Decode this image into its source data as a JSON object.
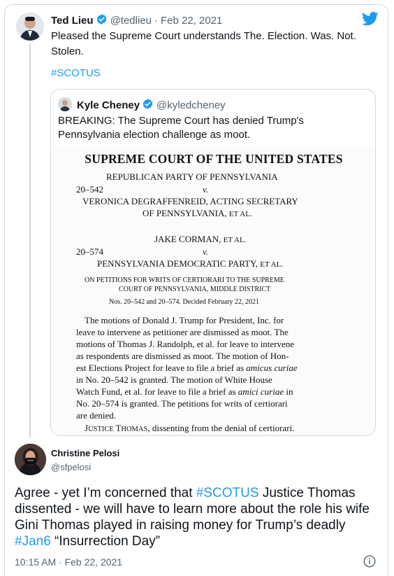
{
  "parent": {
    "name": "Ted Lieu",
    "handle": "@tedlieu",
    "separator": "·",
    "date": "Feb 22, 2021",
    "text": "Pleased the Supreme Court understands The. Election. Was. Not. Stolen.",
    "hashtag": "#SCOTUS"
  },
  "quote": {
    "name": "Kyle Cheney",
    "handle": "@kyledcheney",
    "text": "BREAKING: The Supreme Court has denied Trump's Pennsylvania election challenge as moot.",
    "document": {
      "title": "SUPREME COURT OF THE UNITED STATES",
      "case1_party1": "REPUBLICAN PARTY OF PENNSYLVANIA",
      "case1_number": "20–542",
      "v": "v.",
      "case1_party2_line1": "VERONICA DEGRAFFENREID, ACTING SECRETARY",
      "case1_party2_line2": "OF PENNSYLVANIA,",
      "et_al": "ET AL.",
      "case2_party1": "JAKE CORMAN,",
      "case2_number": "20–574",
      "case2_party2": "PENNSYLVANIA DEMOCRATIC PARTY,",
      "petitions_line1": "ON PETITIONS FOR WRITS OF CERTIORARI TO THE SUPREME",
      "petitions_line2": "COURT OF PENNSYLVANIA, MIDDLE DISTRICT",
      "nos_decided": "Nos. 20–542 and 20–574.   Decided February 22, 2021",
      "body_lines": [
        "The motions of Donald J. Trump for President, Inc. for",
        "leave to intervene as petitioner are dismissed as moot.  The",
        "motions of Thomas J. Randolph, et al. for leave to intervene",
        "as respondents are dismissed as moot.  The motion of Hon-",
        "est Elections Project for leave to file a brief as amicus curiae",
        "in No. 20–542 is granted.  The motion of White House",
        "Watch Fund, et al. for leave to file a brief as amici curiae in",
        "No. 20–574 is granted.  The petitions for writs of certiorari",
        "are denied."
      ],
      "dissent": "JUSTICE THOMAS, dissenting from the denial of certiorari."
    }
  },
  "main": {
    "name": "Christine Pelosi",
    "handle": "@sfpelosi",
    "text_part1": "Agree - yet I’m concerned that ",
    "hashtag1": "#SCOTUS",
    "text_part2": " Justice Thomas dissented - we will have to learn more about the role his wife Gini Thomas played in raising money for Trump’s deadly ",
    "hashtag2": "#Jan6",
    "text_part3": " “Insurrection Day”",
    "timestamp": "10:15 AM · Feb 22, 2021"
  },
  "colors": {
    "accent": "#1d9bf0",
    "verified": "#1d9bf0",
    "secondary_text": "#536471",
    "border": "#cfd9de"
  },
  "icons": [
    "twitter-bird-icon",
    "verified-badge-icon",
    "info-icon"
  ]
}
